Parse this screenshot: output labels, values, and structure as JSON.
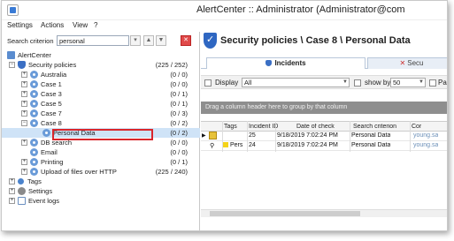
{
  "window": {
    "title": "AlertCenter :: Administrator (Administrator@com"
  },
  "menu": {
    "items": [
      "Settings",
      "Actions",
      "View",
      "?"
    ]
  },
  "search": {
    "label": "Search criterion",
    "value": "personal"
  },
  "tree": {
    "root": "AlertCenter",
    "security_policies": {
      "label": "Security policies",
      "count": "(225 / 252)"
    },
    "cases": [
      {
        "label": "Australia",
        "count": "(0 / 0)"
      },
      {
        "label": "Case 1",
        "count": "(0 / 0)"
      },
      {
        "label": "Case 3",
        "count": "(0 / 1)"
      },
      {
        "label": "Case 5",
        "count": "(0 / 1)"
      },
      {
        "label": "Case 7",
        "count": "(0 / 3)"
      },
      {
        "label": "Case 8",
        "count": "(0 / 2)"
      }
    ],
    "personal_data": {
      "label": "Personal Data",
      "count": "(0 / 2)"
    },
    "others": [
      {
        "label": "DB search",
        "count": "(0 / 0)"
      },
      {
        "label": "Email",
        "count": "(0 / 0)"
      },
      {
        "label": "Printing",
        "count": "(0 / 1)"
      },
      {
        "label": "Upload of files over HTTP",
        "count": "(225 / 240)"
      }
    ],
    "bottom": [
      "Tags",
      "Settings",
      "Event logs"
    ]
  },
  "main": {
    "breadcrumb": "Security policies \\ Case 8 \\ Personal Data",
    "tabs": [
      "Incidents",
      "Secu"
    ],
    "toolbar": {
      "display_label": "Display",
      "display_value": "All",
      "show_by_label": "show by",
      "show_by_value": "50",
      "page_label": "Page"
    },
    "group_hint": "Drag a column header here to group by that column",
    "columns": [
      "Tags",
      "Incident ID",
      "Date of check",
      "Search criterion",
      "Cor"
    ],
    "rows": [
      {
        "tags": "",
        "id": "25",
        "date": "9/18/2019 7:02:24 PM",
        "criterion": "Personal Data",
        "extra": "young.sa"
      },
      {
        "tags": "Pers",
        "id": "24",
        "date": "9/18/2019 7:02:24 PM",
        "criterion": "Personal Data",
        "extra": "young.sa"
      }
    ]
  }
}
